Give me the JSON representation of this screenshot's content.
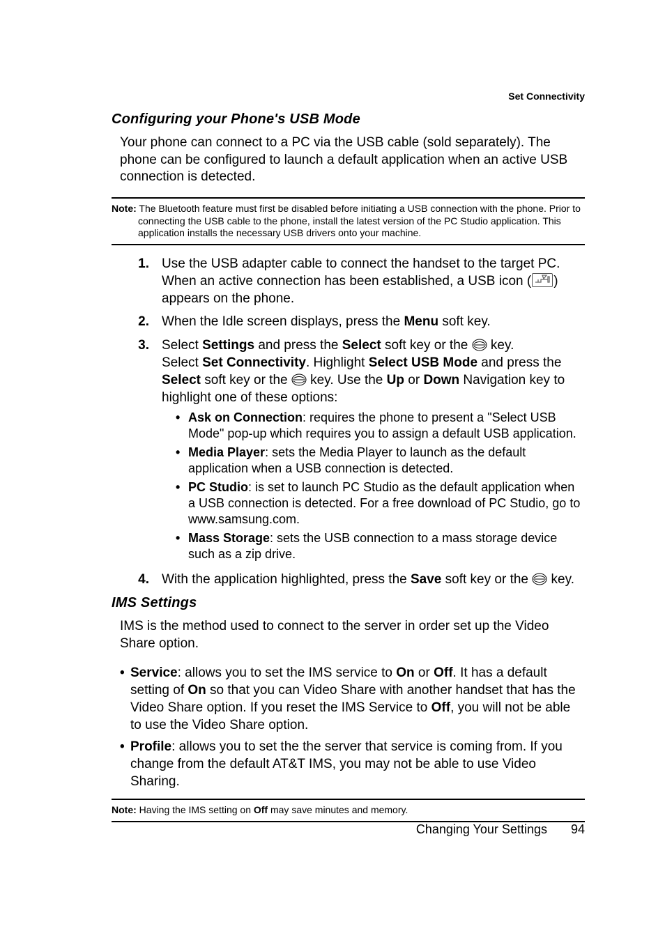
{
  "running_head": "Set Connectivity",
  "section1": {
    "heading": "Configuring your Phone's USB Mode",
    "intro": "Your phone can connect to a PC via the USB cable (sold separately). The phone can be configured to launch a default application when an active USB connection is detected.",
    "note_label": "Note:",
    "note_text": " The Bluetooth feature must first be disabled before initiating a USB connection with the phone. Prior to connecting the USB cable to the phone, install the latest version of the PC Studio application. This application installs the necessary USB drivers onto your machine.",
    "steps": [
      {
        "num": "1.",
        "pre": "Use the USB adapter cable to connect the handset to the target PC. When an active connection has been established, a USB icon (",
        "post": ") appears on the phone.",
        "has_usb_icon": true
      },
      {
        "num": "2.",
        "plain_pre": "When the Idle screen displays, press the ",
        "bold1": "Menu",
        "plain_post": " soft key."
      },
      {
        "num": "3.",
        "line1_a": "Select ",
        "line1_b": "Settings",
        "line1_c": " and press the ",
        "line1_d": "Select",
        "line1_e": " soft key or the ",
        "line1_f": " key.",
        "line2_a": "Select ",
        "line2_b": "Set Connectivity",
        "line2_c": ". Highlight ",
        "line2_d": "Select USB Mode",
        "line2_e": " and press the ",
        "line2_f": "Select",
        "line2_g": " soft key or the ",
        "line2_h": " key. Use the ",
        "line2_i": "Up",
        "line2_j": " or ",
        "line2_k": "Down",
        "line2_l": " Navigation key to highlight one of these options:",
        "bullets": [
          {
            "bold": "Ask on Connection",
            "rest": ": requires the phone to present a \"Select USB Mode\" pop-up which requires you to assign a default USB application."
          },
          {
            "bold": "Media Player",
            "rest": ": sets the Media Player to launch as the default application when a USB connection is detected."
          },
          {
            "bold": "PC Studio",
            "rest": ": is set to launch PC Studio as the default application when a USB connection is detected. For a free download of PC Studio, go to www.samsung.com."
          },
          {
            "bold": "Mass Storage",
            "rest": ": sets the USB connection to a mass storage device such as a zip drive."
          }
        ]
      },
      {
        "num": "4.",
        "p4_a": "With the application highlighted, press the ",
        "p4_b": "Save",
        "p4_c": " soft key or the ",
        "p4_d": " key."
      }
    ]
  },
  "section2": {
    "heading": "IMS Settings",
    "intro": "IMS is the method used to connect to the server in order set up the Video Share option.",
    "bullets": [
      {
        "bold": "Service",
        "a": ": allows you to set the IMS service to ",
        "b": "On",
        "c": " or ",
        "d": "Off",
        "e": ". It has a default setting of ",
        "f": "On",
        "g": " so that you can Video Share with another handset that has the Video Share option. If you reset the IMS Service to ",
        "h": "Off",
        "i": ", you will not be able to use the Video Share option."
      },
      {
        "bold": "Profile",
        "a": ": allows you to set the the server that service is coming from. If you change from the default AT&T IMS, you may not be able to use Video Sharing."
      }
    ],
    "note_label": "Note:",
    "note_a": " Having the IMS setting on ",
    "note_b": "Off",
    "note_c": " may save minutes and memory."
  },
  "footer": {
    "chapter": "Changing Your Settings",
    "page": "94"
  }
}
